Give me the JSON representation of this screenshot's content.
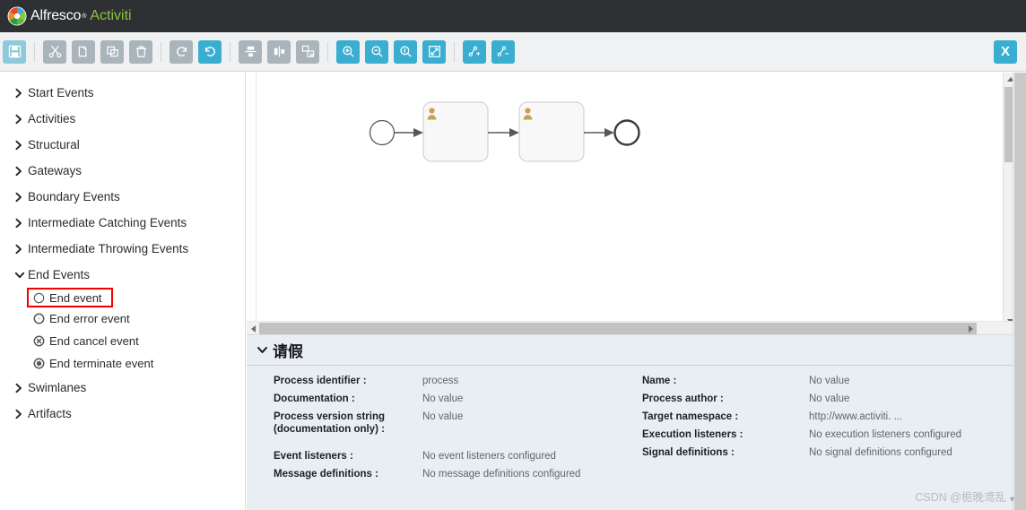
{
  "titlebar": {
    "brand_primary": "Alfresco",
    "brand_secondary": "Activiti",
    "logo_icon": "alfresco-pinwheel-logo",
    "background": "#2e3033",
    "accent": "#8bc53f"
  },
  "toolbar": {
    "accent_active": "#3aaed0",
    "accent_light": "#8ecad9",
    "disabled": "#a9b5ba",
    "buttons": [
      {
        "name": "save-button",
        "icon": "floppy-disk-icon",
        "state": "light"
      },
      {
        "name": "cut-button",
        "icon": "scissors-icon",
        "state": "disabled"
      },
      {
        "name": "copy-button",
        "icon": "copy-icon",
        "state": "disabled"
      },
      {
        "name": "paste-button",
        "icon": "paste-icon",
        "state": "disabled"
      },
      {
        "name": "delete-button",
        "icon": "trash-icon",
        "state": "disabled"
      },
      {
        "name": "redo-button",
        "icon": "redo-arrow-icon",
        "state": "disabled"
      },
      {
        "name": "undo-button",
        "icon": "undo-arrow-icon",
        "state": "active"
      },
      {
        "name": "align-vertical-button",
        "icon": "align-vertical-icon",
        "state": "disabled"
      },
      {
        "name": "align-horizontal-button",
        "icon": "align-horizontal-icon",
        "state": "disabled"
      },
      {
        "name": "same-size-button",
        "icon": "resize-same-size-icon",
        "state": "disabled"
      },
      {
        "name": "zoom-in-button",
        "icon": "magnifier-plus-icon",
        "state": "active"
      },
      {
        "name": "zoom-out-button",
        "icon": "magnifier-minus-icon",
        "state": "active"
      },
      {
        "name": "zoom-actual-button",
        "icon": "magnifier-one-icon",
        "state": "active"
      },
      {
        "name": "zoom-fit-button",
        "icon": "fit-to-screen-icon",
        "state": "active"
      },
      {
        "name": "add-bendpoint-button",
        "icon": "bendpoint-plus-icon",
        "state": "active"
      },
      {
        "name": "remove-bendpoint-button",
        "icon": "bendpoint-minus-icon",
        "state": "active"
      }
    ],
    "close_label": "X"
  },
  "palette": {
    "groups": [
      {
        "label": "Start Events",
        "expanded": false,
        "items": []
      },
      {
        "label": "Activities",
        "expanded": false,
        "items": []
      },
      {
        "label": "Structural",
        "expanded": false,
        "items": []
      },
      {
        "label": "Gateways",
        "expanded": false,
        "items": []
      },
      {
        "label": "Boundary Events",
        "expanded": false,
        "items": []
      },
      {
        "label": "Intermediate Catching Events",
        "expanded": false,
        "items": []
      },
      {
        "label": "Intermediate Throwing Events",
        "expanded": false,
        "items": []
      },
      {
        "label": "End Events",
        "expanded": true,
        "items": [
          {
            "label": "End event",
            "icon": "end-event-circle-icon",
            "selected": true
          },
          {
            "label": "End error event",
            "icon": "end-error-event-icon",
            "selected": false
          },
          {
            "label": "End cancel event",
            "icon": "end-cancel-event-icon",
            "selected": false
          },
          {
            "label": "End terminate event",
            "icon": "end-terminate-event-icon",
            "selected": false
          }
        ]
      },
      {
        "label": "Swimlanes",
        "expanded": false,
        "items": []
      },
      {
        "label": "Artifacts",
        "expanded": false,
        "items": []
      }
    ],
    "selection_border_color": "#f50000"
  },
  "canvas": {
    "diagram_name": "bpmn-process-diagram",
    "nodes": [
      {
        "name": "start-event",
        "type": "start-event"
      },
      {
        "name": "user-task-1",
        "type": "user-task",
        "label": ""
      },
      {
        "name": "user-task-2",
        "type": "user-task",
        "label": ""
      },
      {
        "name": "end-event",
        "type": "end-event"
      }
    ],
    "flows": [
      {
        "from": "start-event",
        "to": "user-task-1"
      },
      {
        "from": "user-task-1",
        "to": "user-task-2"
      },
      {
        "from": "user-task-2",
        "to": "end-event"
      }
    ]
  },
  "properties": {
    "title": "请假",
    "left_rows": [
      {
        "label": "Process identifier :",
        "value": "process"
      },
      {
        "label": "Documentation :",
        "value": "No value"
      },
      {
        "label": "Process version string (documentation only) :",
        "value": "No value"
      },
      {
        "label": "Event listeners :",
        "value": "No event listeners configured"
      },
      {
        "label": "Message definitions :",
        "value": "No message definitions configured"
      }
    ],
    "right_rows": [
      {
        "label": "Name :",
        "value": "No value"
      },
      {
        "label": "Process author :",
        "value": "No value"
      },
      {
        "label": "Target namespace :",
        "value": "http://www.activiti. ..."
      },
      {
        "label": "Execution listeners :",
        "value": "No execution listeners configured"
      },
      {
        "label": "Signal definitions :",
        "value": "No signal definitions configured"
      }
    ]
  },
  "watermark": {
    "text": "CSDN @栀晚鸢乱"
  }
}
